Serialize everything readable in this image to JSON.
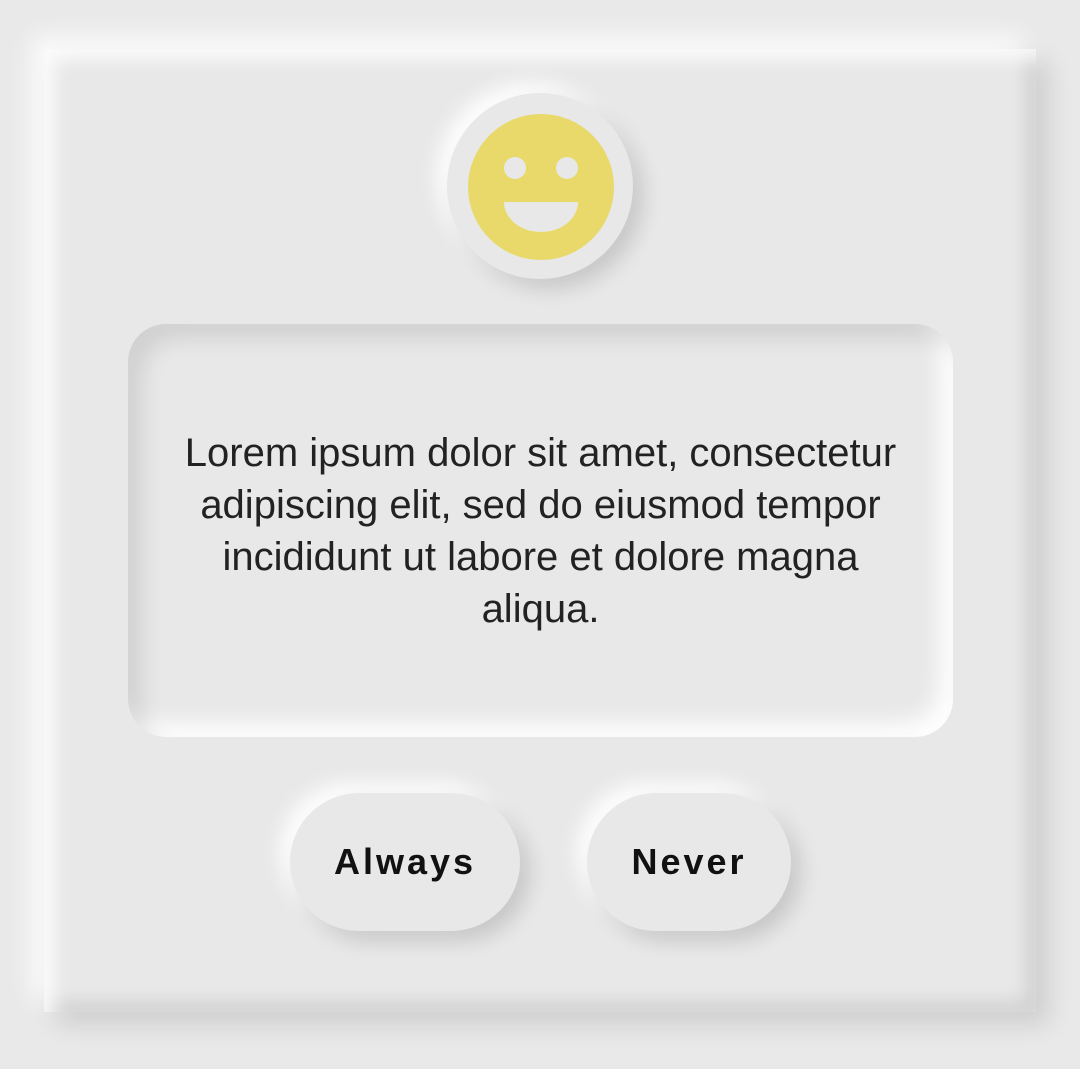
{
  "dialog": {
    "icon": "smiley-face-icon",
    "message": "Lorem ipsum dolor sit amet, consectetur adipiscing elit, sed do eiusmod tempor incididunt ut labore et dolore magna aliqua.",
    "buttons": {
      "always_label": "Always",
      "never_label": "Never"
    }
  },
  "colors": {
    "background": "#e8e8e8",
    "smiley": "#e8d96a",
    "text": "#222222"
  }
}
